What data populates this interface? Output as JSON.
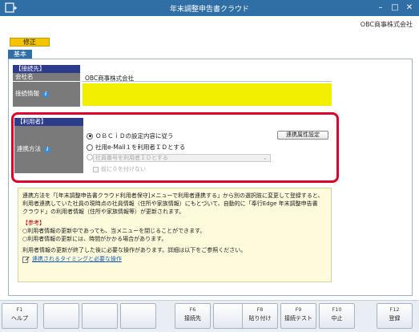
{
  "window": {
    "title": "年末調整申告書クラウド",
    "company": "OBC商事株式会社"
  },
  "mode_badge": "修正",
  "tab": "基本",
  "connection": {
    "section": "【接続先】",
    "company_label": "会社名",
    "company_value": "OBC商事株式会社",
    "info_label": "接続情報"
  },
  "user_section": {
    "section": "【利用者】",
    "method_label": "連携方法",
    "options": [
      "ＯＢＣｉＤの設定内容に従う",
      "社用e-Mail１を利用者ＩＤとする",
      "社員番号を利用者ＩＤとする"
    ],
    "selected_index": 0,
    "settings_button": "連携属性設定",
    "zero_pad_label": "前に０を付けない"
  },
  "note": {
    "body": "連携方法を「[年末調整申告書クラウド利用者保守]メニューで利用者連携する」から別の選択肢に変更して登録すると、\n利用者連携していた社員の現時点の社員情報（住所や家族情報）にもとづいて、自動的に「奉行Edge 年末調整申告書\nクラウド」の利用者情報（住所や家族情報等）が更新されます。",
    "ref_head": "【参考】",
    "ref_lines": [
      "○利用者情報の更新中であっても、当メニューを閉じることができます。",
      "○利用者情報の更新には、時間がかかる場合があります。"
    ],
    "footer": "利用者情報の更新が終了した後に必要な操作があります。詳細は以下をご参照ください。",
    "link": "連携されるタイミングと必要な操作"
  },
  "fkeys": [
    {
      "key": "F1",
      "label": "ヘルプ"
    },
    {
      "key": "",
      "label": ""
    },
    {
      "key": "",
      "label": ""
    },
    {
      "key": "",
      "label": ""
    },
    {
      "key": "F6",
      "label": "接続先"
    },
    {
      "key": "",
      "label": ""
    },
    {
      "key": "F8",
      "label": "貼り付け"
    },
    {
      "key": "F9",
      "label": "接続テスト"
    },
    {
      "key": "F10",
      "label": "中止"
    },
    {
      "key": "F12",
      "label": "登録"
    }
  ],
  "colors": {
    "titlebar": "#2f6fa6",
    "section": "#2d3b8c",
    "highlight": "#e0002a",
    "info_field": "#f2ef00",
    "badge": "#f3c400"
  }
}
